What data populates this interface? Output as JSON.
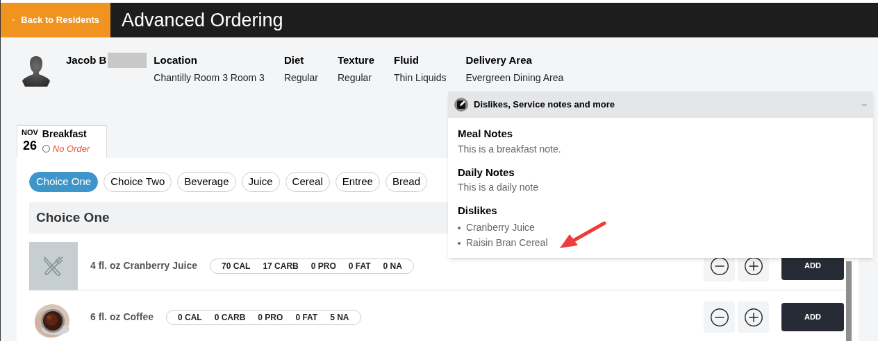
{
  "header": {
    "back_label": "Back to Residents",
    "title": "Advanced Ordering"
  },
  "resident": {
    "name": "Jacob B",
    "fields": [
      {
        "label": "Location",
        "value": "Chantilly Room 3 Room 3"
      },
      {
        "label": "Diet",
        "value": "Regular"
      },
      {
        "label": "Texture",
        "value": "Regular"
      },
      {
        "label": "Fluid",
        "value": "Thin Liquids"
      },
      {
        "label": "Delivery Area",
        "value": "Evergreen Dining Area"
      }
    ]
  },
  "meal_tab": {
    "month": "NOV",
    "day": "26",
    "meal": "Breakfast",
    "status": "No Order"
  },
  "categories": [
    {
      "label": "Choice One",
      "selected": true
    },
    {
      "label": "Choice Two",
      "selected": false
    },
    {
      "label": "Beverage",
      "selected": false
    },
    {
      "label": "Juice",
      "selected": false
    },
    {
      "label": "Cereal",
      "selected": false
    },
    {
      "label": "Entree",
      "selected": false
    },
    {
      "label": "Bread",
      "selected": false
    }
  ],
  "section_title": "Choice One",
  "items": [
    {
      "name": "4 fl. oz Cranberry Juice",
      "kind": "placeholder",
      "nutrition": [
        "70 CAL",
        "17 CARB",
        "0 PRO",
        "0 FAT",
        "0 NA"
      ],
      "add_label": "ADD"
    },
    {
      "name": "6 fl. oz Coffee",
      "nutrition": [
        "0 CAL",
        "0 CARB",
        "0 PRO",
        "0 FAT",
        "5 NA"
      ],
      "add_label": "ADD"
    }
  ],
  "notes_panel": {
    "title": "Dislikes, Service notes and more",
    "toggle": "–",
    "expanded": true,
    "sections": [
      {
        "heading": "Meal Notes",
        "text": "This is a breakfast note."
      },
      {
        "heading": "Daily Notes",
        "text": "This is a daily note"
      }
    ],
    "dislikes": {
      "heading": "Dislikes",
      "items": [
        "Cranberry Juice",
        "Raisin Bran Cereal"
      ]
    }
  }
}
